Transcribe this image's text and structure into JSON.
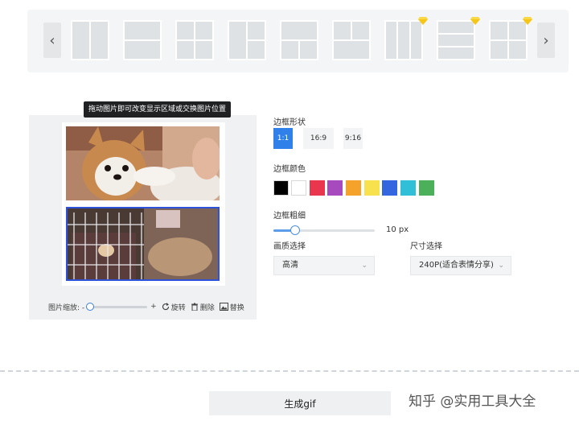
{
  "layouts": {
    "prev_icon": "chevron-left-icon",
    "next_icon": "chevron-right-icon",
    "items": [
      {
        "name": "layout-2-columns",
        "premium": false
      },
      {
        "name": "layout-2-rows",
        "premium": false
      },
      {
        "name": "layout-2x2-grid",
        "premium": false
      },
      {
        "name": "layout-left-plus-2-right",
        "premium": false
      },
      {
        "name": "layout-top-plus-2-bottom",
        "premium": false
      },
      {
        "name": "layout-2-top-plus-bottom",
        "premium": false
      },
      {
        "name": "layout-3-columns",
        "premium": true
      },
      {
        "name": "layout-3-rows",
        "premium": true
      },
      {
        "name": "layout-2-top-plus-2-bottom",
        "premium": true
      }
    ],
    "premium_icon": "diamond-icon",
    "premium_color": "#f5c518"
  },
  "editor": {
    "tooltip": "拖动图片即可改变显示区域或交换图片位置",
    "zoom_label": "图片缩放: -",
    "zoom_plus": "+",
    "rotate_label": "旋转",
    "delete_label": "删除",
    "replace_label": "替换",
    "selected_border_color": "#2c53d9"
  },
  "settings": {
    "shape_label": "边框形状",
    "shapes": [
      "1:1",
      "16:9",
      "9:16"
    ],
    "active_shape": "1:1",
    "color_label": "边框颜色",
    "colors": [
      "#000000",
      "#ffffff",
      "#e8364e",
      "#a54bbd",
      "#f5a22a",
      "#f7e14d",
      "#3466e0",
      "#2fbfd6",
      "#4caf5a"
    ],
    "thickness_label": "边框粗细",
    "thickness_value": "10 px",
    "quality_label": "画质选择",
    "quality_value": "高清",
    "size_label": "尺寸选择",
    "size_value": "240P(适合表情分享)"
  },
  "actions": {
    "generate_label": "生成gif"
  },
  "watermark": "知乎 @实用工具大全",
  "accent_color": "#2f80e8"
}
